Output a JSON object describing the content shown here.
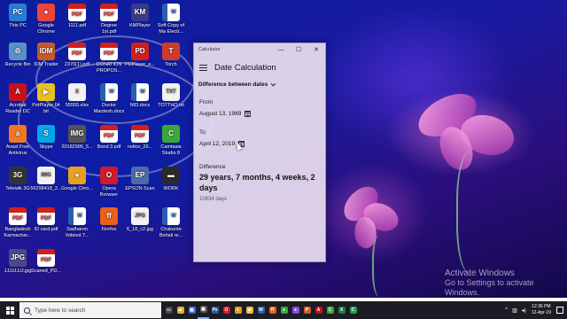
{
  "desktop": {
    "icons": [
      {
        "label": "This PC",
        "glyph": "PC",
        "kind": "pc",
        "color": "#2b7cd3"
      },
      {
        "label": "Google Chrome",
        "glyph": "●",
        "kind": "app",
        "color": "#e9453b"
      },
      {
        "label": "1111.pdf",
        "glyph": "PDF",
        "kind": "pdf"
      },
      {
        "label": "Degree 1st.pdf",
        "glyph": "PDF",
        "kind": "pdf"
      },
      {
        "label": "KMPlayer",
        "glyph": "KM",
        "kind": "app",
        "color": "#3a3a8a"
      },
      {
        "label": "Soft Copy of Ma Electi...",
        "glyph": "W",
        "kind": "doc"
      },
      {
        "label": "Recycle Bin",
        "glyph": "♲",
        "kind": "app",
        "color": "#5a8fc8"
      },
      {
        "label": "IDM Trader",
        "glyph": "IDM",
        "kind": "app",
        "color": "#c85a2a"
      },
      {
        "label": "2370(1).pdf",
        "glyph": "PDF",
        "kind": "pdf"
      },
      {
        "label": "DONATION PROPOS...",
        "glyph": "PDF",
        "kind": "pdf"
      },
      {
        "label": "PDPlayer_e...",
        "glyph": "PD",
        "kind": "app",
        "color": "#d0201c"
      },
      {
        "label": "Torch",
        "glyph": "T",
        "kind": "app",
        "color": "#d03a2a"
      },
      {
        "label": "Acrobat Reader DC",
        "glyph": "A",
        "kind": "app",
        "color": "#c8101c"
      },
      {
        "label": "PotPlayer 64 bit",
        "glyph": "▶",
        "kind": "app",
        "color": "#e8c020"
      },
      {
        "label": "55555.xlsx",
        "glyph": "X",
        "kind": "file"
      },
      {
        "label": "Doctor Mardesh.docx",
        "glyph": "W",
        "kind": "doc"
      },
      {
        "label": "NID.docx",
        "glyph": "W",
        "kind": "doc"
      },
      {
        "label": "TOTTHO.txt",
        "glyph": "TXT",
        "kind": "file"
      },
      {
        "label": "Avast Free Antivirus",
        "glyph": "a",
        "kind": "app",
        "color": "#f07820"
      },
      {
        "label": "Skype",
        "glyph": "S",
        "kind": "app",
        "color": "#00a8e8"
      },
      {
        "label": "20182996_5...",
        "glyph": "IMG",
        "kind": "app",
        "color": "#555555"
      },
      {
        "label": "Bond 3.pdf",
        "glyph": "PDF",
        "kind": "pdf"
      },
      {
        "label": "notice_26...",
        "glyph": "PDF",
        "kind": "pdf"
      },
      {
        "label": "Camtasia Studio 8",
        "glyph": "C",
        "kind": "app",
        "color": "#3aa83a"
      },
      {
        "label": "Teletalk 3G",
        "glyph": "3G",
        "kind": "app",
        "color": "#333333"
      },
      {
        "label": "56298418_2...",
        "glyph": "IMG",
        "kind": "file"
      },
      {
        "label": "Google Chro...",
        "glyph": "●",
        "kind": "app",
        "color": "#e8a020"
      },
      {
        "label": "Opera Browser",
        "glyph": "O",
        "kind": "app",
        "color": "#d01a2a"
      },
      {
        "label": "EPSON Scan",
        "glyph": "EP",
        "kind": "app",
        "color": "#4a6aa8"
      },
      {
        "label": "WORK",
        "glyph": "▬",
        "kind": "app",
        "color": "#2a2a2a"
      },
      {
        "label": "Bangladesh Karmachar...",
        "glyph": "PDF",
        "kind": "pdf"
      },
      {
        "label": "ID card.pdf",
        "glyph": "PDF",
        "kind": "pdf"
      },
      {
        "label": "Sadharon Vobisot T...",
        "glyph": "W",
        "kind": "doc"
      },
      {
        "label": "Firefox",
        "glyph": "ff",
        "kind": "app",
        "color": "#e8601c"
      },
      {
        "label": "6_18_c2.jpg",
        "glyph": "JPG",
        "kind": "file"
      },
      {
        "label": "Chakunte Bohali re...",
        "glyph": "W",
        "kind": "doc"
      },
      {
        "label": "JJJJJJJJ.jpg",
        "glyph": "JPG",
        "kind": "app",
        "color": "#4a4a8a"
      },
      {
        "label": "Scaned_PD...",
        "glyph": "PDF",
        "kind": "pdf"
      }
    ]
  },
  "calculator": {
    "window_title": "Calculator",
    "heading": "Date Calculation",
    "mode": "Difference between dates",
    "from_label": "From",
    "from_date": "August 13, 1989",
    "to_label": "To",
    "to_date": "April 12, 2019",
    "difference_label": "Difference",
    "difference_value": "29 years, 7 months, 4 weeks, 2 days",
    "difference_days": "10834 days"
  },
  "watermark": {
    "title": "Activate Windows",
    "subtitle": "Go to Settings to activate Windows."
  },
  "taskbar": {
    "search_placeholder": "Type here to search",
    "pinned": [
      {
        "name": "task-view-icon",
        "glyph": "▭",
        "color": "#444444"
      },
      {
        "name": "explorer-icon",
        "glyph": "▰",
        "color": "#e8b020"
      },
      {
        "name": "store-icon",
        "glyph": "▣",
        "color": "#3a6ad8"
      },
      {
        "name": "calculator-icon",
        "glyph": "▦",
        "color": "#555555",
        "active": true
      },
      {
        "name": "photoshop-icon",
        "glyph": "Ps",
        "color": "#2a5a9a"
      },
      {
        "name": "opera-icon",
        "glyph": "O",
        "color": "#d01a2a"
      },
      {
        "name": "chrome-icon",
        "glyph": "●",
        "color": "#d8a020"
      },
      {
        "name": "folder-icon",
        "glyph": "▰",
        "color": "#e8c040"
      },
      {
        "name": "word-icon",
        "glyph": "W",
        "color": "#2a5fb0"
      },
      {
        "name": "firefox-icon",
        "glyph": "ff",
        "color": "#e8601c"
      },
      {
        "name": "chrome2-icon",
        "glyph": "●",
        "color": "#3aa83a"
      },
      {
        "name": "app-icon",
        "glyph": "●",
        "color": "#8a4ad8"
      },
      {
        "name": "powerpoint-icon",
        "glyph": "P",
        "color": "#d05a2a"
      },
      {
        "name": "acrobat-icon",
        "glyph": "A",
        "color": "#c8101c"
      },
      {
        "name": "camtasia-icon",
        "glyph": "C",
        "color": "#3aa83a"
      },
      {
        "name": "excel-icon",
        "glyph": "X",
        "color": "#1e7a3e"
      },
      {
        "name": "camtasia2-icon",
        "glyph": "C",
        "color": "#2a9a4a"
      }
    ],
    "tray_up_glyph": "^",
    "tray_network_glyph": "▥",
    "tray_volume_glyph": "◂)",
    "clock_time": "12:36 PM",
    "clock_date": "12-Apr-19"
  }
}
